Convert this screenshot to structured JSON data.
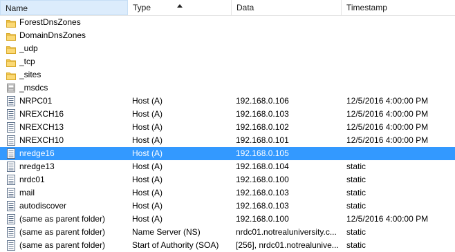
{
  "columns": {
    "name": "Name",
    "type": "Type",
    "data": "Data",
    "timestamp": "Timestamp"
  },
  "rows": [
    {
      "icon": "folder-icon",
      "name": "ForestDnsZones",
      "type": "",
      "data": "",
      "timestamp": ""
    },
    {
      "icon": "folder-icon",
      "name": "DomainDnsZones",
      "type": "",
      "data": "",
      "timestamp": ""
    },
    {
      "icon": "folder-icon",
      "name": "_udp",
      "type": "",
      "data": "",
      "timestamp": ""
    },
    {
      "icon": "folder-icon",
      "name": "_tcp",
      "type": "",
      "data": "",
      "timestamp": ""
    },
    {
      "icon": "folder-icon",
      "name": "_sites",
      "type": "",
      "data": "",
      "timestamp": ""
    },
    {
      "icon": "delegation-icon",
      "name": "_msdcs",
      "type": "",
      "data": "",
      "timestamp": ""
    },
    {
      "icon": "record-icon",
      "name": "NRPC01",
      "type": "Host (A)",
      "data": "192.168.0.106",
      "timestamp": "12/5/2016 4:00:00 PM"
    },
    {
      "icon": "record-icon",
      "name": "NREXCH16",
      "type": "Host (A)",
      "data": "192.168.0.103",
      "timestamp": "12/5/2016 4:00:00 PM"
    },
    {
      "icon": "record-icon",
      "name": "NREXCH13",
      "type": "Host (A)",
      "data": "192.168.0.102",
      "timestamp": "12/5/2016 4:00:00 PM"
    },
    {
      "icon": "record-icon",
      "name": "NREXCH10",
      "type": "Host (A)",
      "data": "192.168.0.101",
      "timestamp": "12/5/2016 4:00:00 PM"
    },
    {
      "icon": "record-icon",
      "name": "nredge16",
      "type": "Host (A)",
      "data": "192.168.0.105",
      "timestamp": "",
      "selected": true
    },
    {
      "icon": "record-icon",
      "name": "nredge13",
      "type": "Host (A)",
      "data": "192.168.0.104",
      "timestamp": "static"
    },
    {
      "icon": "record-icon",
      "name": "nrdc01",
      "type": "Host (A)",
      "data": "192.168.0.100",
      "timestamp": "static"
    },
    {
      "icon": "record-icon",
      "name": "mail",
      "type": "Host (A)",
      "data": "192.168.0.103",
      "timestamp": "static"
    },
    {
      "icon": "record-icon",
      "name": "autodiscover",
      "type": "Host (A)",
      "data": "192.168.0.103",
      "timestamp": "static"
    },
    {
      "icon": "record-icon",
      "name": "(same as parent folder)",
      "type": "Host (A)",
      "data": "192.168.0.100",
      "timestamp": "12/5/2016 4:00:00 PM"
    },
    {
      "icon": "record-icon",
      "name": "(same as parent folder)",
      "type": "Name Server (NS)",
      "data": "nrdc01.notrealuniversity.c...",
      "timestamp": "static"
    },
    {
      "icon": "record-icon",
      "name": "(same as parent folder)",
      "type": "Start of Authority (SOA)",
      "data": "[256], nrdc01.notrealunive...",
      "timestamp": "static"
    }
  ],
  "colors": {
    "selection": "#3399ff",
    "header_active": "#dcecfc",
    "folder": "#f3c94f"
  }
}
